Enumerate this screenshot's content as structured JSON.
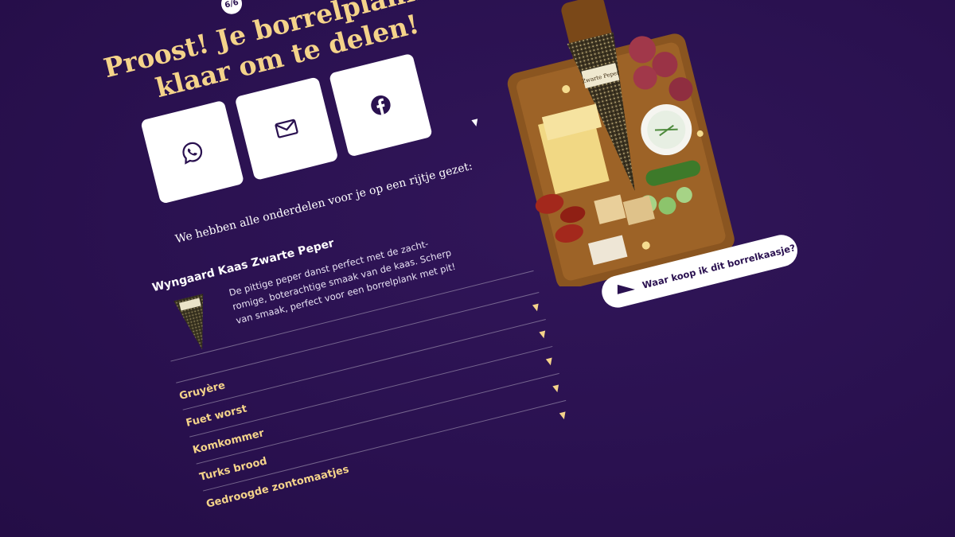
{
  "step": {
    "label": "6/6"
  },
  "title": "Proost! Je borrelplank is klaar om te delen!",
  "share": {
    "buttons": [
      {
        "name": "whatsapp",
        "icon": "whatsapp-icon"
      },
      {
        "name": "email",
        "icon": "mail-icon"
      },
      {
        "name": "facebook",
        "icon": "facebook-icon"
      }
    ]
  },
  "intro": "We hebben alle onderdelen voor je op een rijtje gezet:",
  "product": {
    "name": "Wyngaard Kaas Zwarte Peper",
    "description": "De pittige peper danst perfect met de zacht-romige, boterachtige smaak van de kaas. Scherp van smaak, perfect voor een borrelplank met pit!",
    "label_title": "Zwarte Peper"
  },
  "items": [
    {
      "label": "Gruyère"
    },
    {
      "label": "Fuet worst"
    },
    {
      "label": "Komkommer"
    },
    {
      "label": "Turks brood"
    },
    {
      "label": "Gedroogde zontomaatjes"
    }
  ],
  "cta": {
    "label": "Waar koop ik dit borrelkaasje?"
  },
  "colors": {
    "background": "#2a1150",
    "accent": "#f4d38a",
    "white": "#ffffff"
  }
}
